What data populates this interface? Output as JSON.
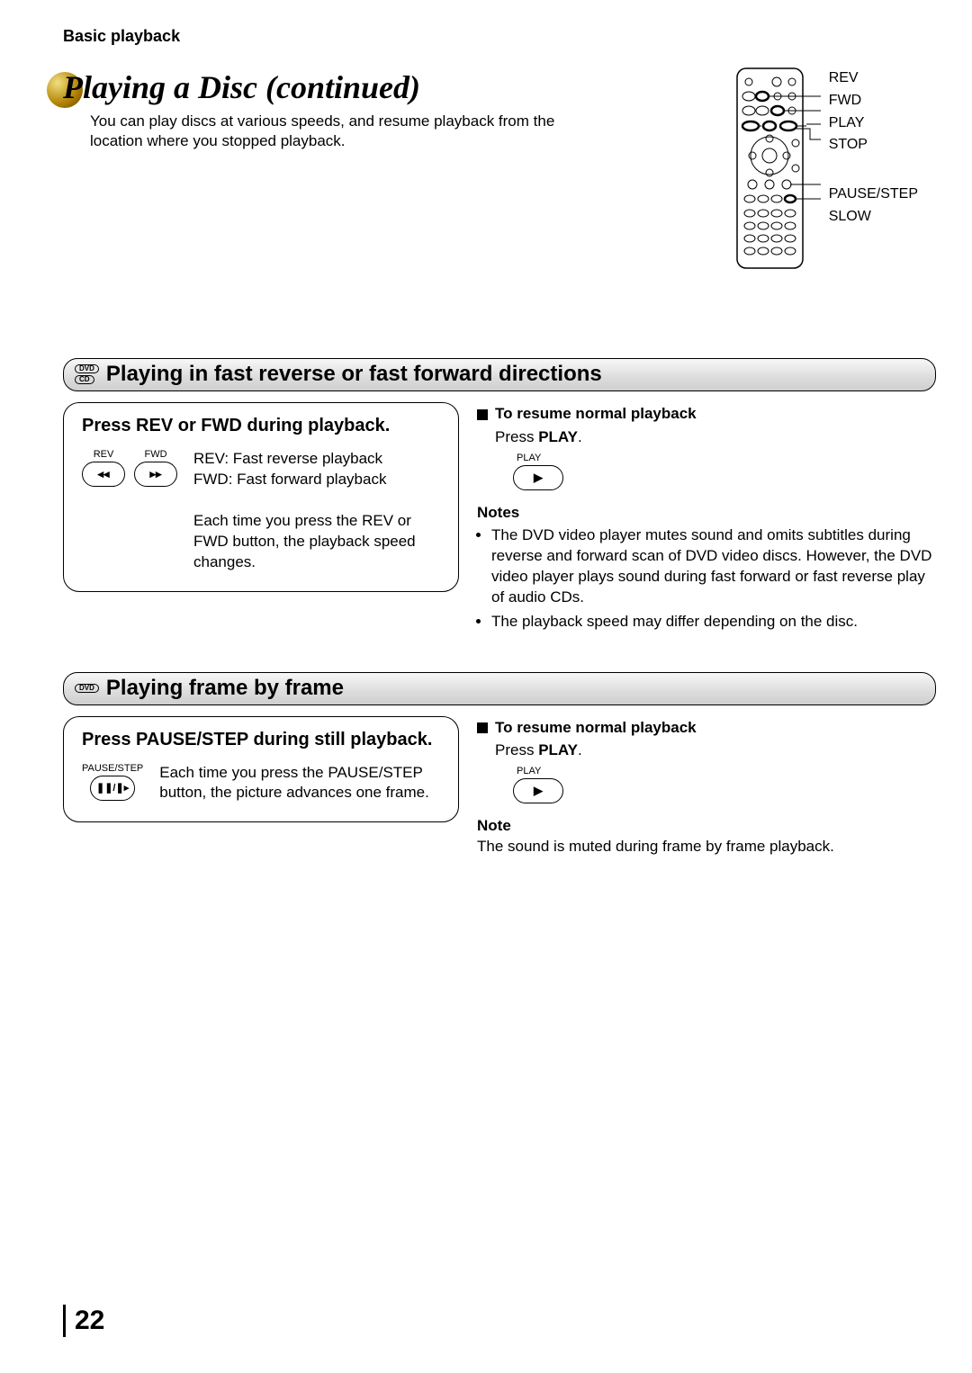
{
  "breadcrumb": "Basic playback",
  "title": "Playing a Disc (continued)",
  "intro": "You can play discs at various speeds, and resume playback from the location where you stopped playback.",
  "remote_labels": [
    "REV",
    "FWD",
    "PLAY",
    "STOP",
    "PAUSE/STEP",
    "SLOW"
  ],
  "section1": {
    "badges": [
      "DVD",
      "CD"
    ],
    "title": "Playing in fast reverse or fast forward directions",
    "left": {
      "heading": "Press REV or FWD during playback.",
      "btn_rev": "REV",
      "btn_fwd": "FWD",
      "desc1a": "REV: Fast reverse playback",
      "desc1b": "FWD: Fast forward playback",
      "desc2": "Each time you press the REV or FWD button, the playback speed changes."
    },
    "right": {
      "resume_head": "To resume normal playback",
      "resume_text_a": "Press ",
      "resume_text_b": "PLAY",
      "play_label": "PLAY",
      "notes_head": "Notes",
      "notes": [
        "The DVD video player mutes sound and omits subtitles during reverse and forward scan of DVD video discs. However, the DVD video player plays sound during fast forward or fast reverse play of audio CDs.",
        "The playback speed may differ depending on the disc."
      ]
    }
  },
  "section2": {
    "badges": [
      "DVD"
    ],
    "title": "Playing frame by frame",
    "left": {
      "heading": "Press PAUSE/STEP during still playback.",
      "btn_pause": "PAUSE/STEP",
      "desc": "Each time you press the PAUSE/STEP button, the picture advances one frame."
    },
    "right": {
      "resume_head": "To resume normal playback",
      "resume_text_a": "Press ",
      "resume_text_b": "PLAY",
      "play_label": "PLAY",
      "note_head": "Note",
      "note": "The sound is muted during frame by frame playback."
    }
  },
  "page_number": "22"
}
